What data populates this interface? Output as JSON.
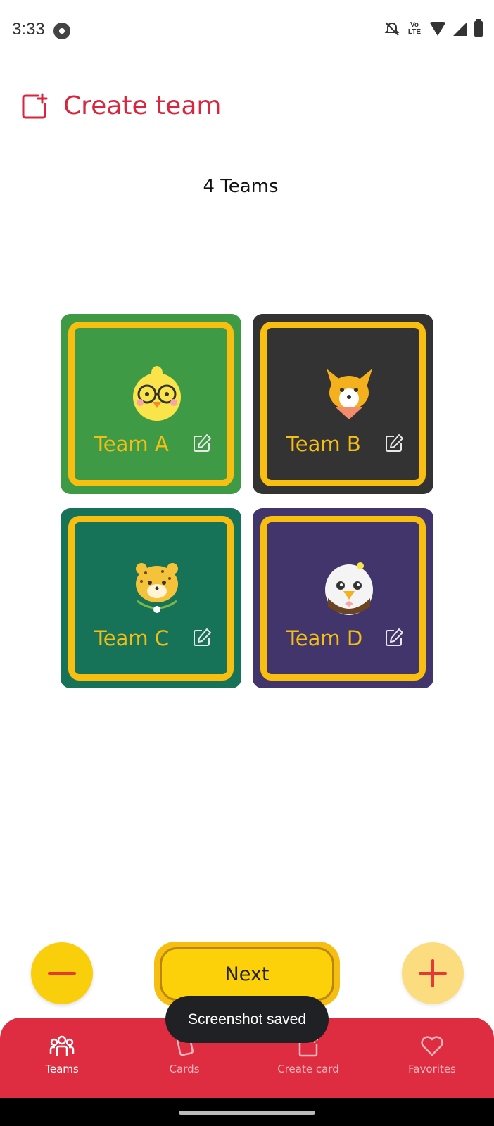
{
  "status_bar": {
    "time": "3:33",
    "volte": "Vo LTE",
    "icons": [
      "settings-icon",
      "bell-off-icon",
      "volte-icon",
      "wifi-icon",
      "signal-icon",
      "battery-icon"
    ]
  },
  "header": {
    "title": "Create team",
    "icon": "add-box-icon",
    "color": "#d7263d"
  },
  "teams_count": "4 Teams",
  "teams": [
    {
      "name": "Team A",
      "bg": "#3f9a46",
      "avatar": "chick-with-glasses-icon"
    },
    {
      "name": "Team B",
      "bg": "#333333",
      "avatar": "corgi-icon"
    },
    {
      "name": "Team C",
      "bg": "#177358",
      "avatar": "leopard-icon"
    },
    {
      "name": "Team D",
      "bg": "#41356b",
      "avatar": "eagle-icon"
    }
  ],
  "actions": {
    "next_label": "Next",
    "minus_icon": "minus-icon",
    "plus_icon": "plus-icon"
  },
  "toast": "Screenshot saved",
  "bottom_nav": {
    "items": [
      {
        "label": "Teams",
        "icon": "teams-icon",
        "active": true
      },
      {
        "label": "Cards",
        "icon": "cards-icon",
        "active": false
      },
      {
        "label": "Create card",
        "icon": "create-card-icon",
        "active": false
      },
      {
        "label": "Favorites",
        "icon": "heart-icon",
        "active": false
      }
    ]
  },
  "colors": {
    "accent_red": "#de2c41",
    "gold_border": "#f8be10",
    "button_yellow": "#fcd10a"
  }
}
